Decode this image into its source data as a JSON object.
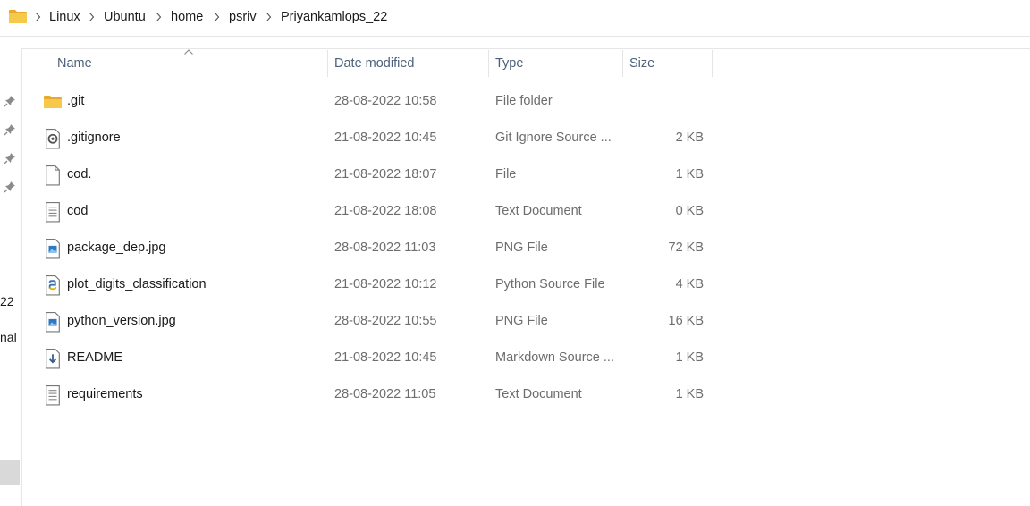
{
  "breadcrumb": [
    "Linux",
    "Ubuntu",
    "home",
    "psriv",
    "Priyankamlops_22"
  ],
  "columns": {
    "name": "Name",
    "date_modified": "Date modified",
    "type": "Type",
    "size": "Size"
  },
  "nav": {
    "partial_labels": [
      "22",
      "nal"
    ]
  },
  "files": [
    {
      "icon": "folder-icon",
      "name": ".git",
      "date": "28-08-2022 10:58",
      "type": "File folder",
      "size": ""
    },
    {
      "icon": "gitignore-file-icon",
      "name": ".gitignore",
      "date": "21-08-2022 10:45",
      "type": "Git Ignore Source ...",
      "size": "2 KB"
    },
    {
      "icon": "blank-file-icon",
      "name": "cod.",
      "date": "21-08-2022 18:07",
      "type": "File",
      "size": "1 KB"
    },
    {
      "icon": "text-document-icon",
      "name": "cod",
      "date": "21-08-2022 18:08",
      "type": "Text Document",
      "size": "0 KB"
    },
    {
      "icon": "image-file-icon",
      "name": "package_dep.jpg",
      "date": "28-08-2022 11:03",
      "type": "PNG File",
      "size": "72 KB"
    },
    {
      "icon": "python-file-icon",
      "name": "plot_digits_classification",
      "date": "21-08-2022 10:12",
      "type": "Python Source File",
      "size": "4 KB"
    },
    {
      "icon": "image-file-icon",
      "name": "python_version.jpg",
      "date": "28-08-2022 10:55",
      "type": "PNG File",
      "size": "16 KB"
    },
    {
      "icon": "markdown-file-icon",
      "name": "README",
      "date": "21-08-2022 10:45",
      "type": "Markdown Source ...",
      "size": "1 KB"
    },
    {
      "icon": "text-document-icon",
      "name": "requirements",
      "date": "28-08-2022 11:05",
      "type": "Text Document",
      "size": "1 KB"
    }
  ],
  "colors": {
    "folder": "#f5c342",
    "header_text": "#4c607a",
    "secondary_text": "#6d6d6d"
  }
}
